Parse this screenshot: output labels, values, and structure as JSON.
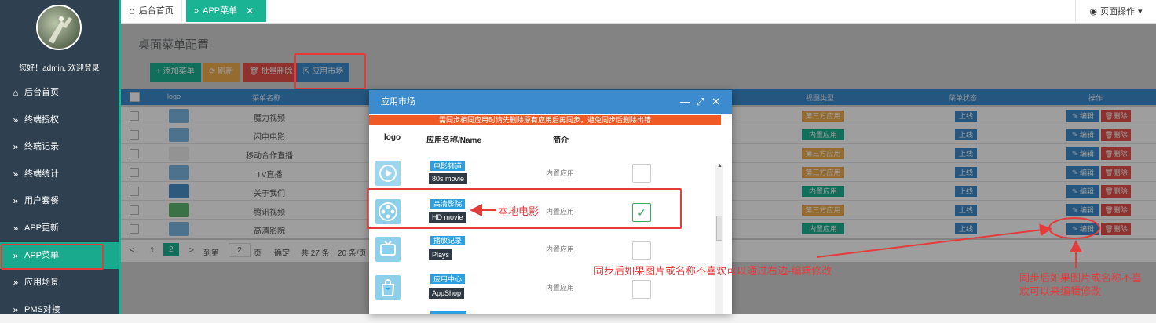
{
  "sidebar": {
    "welcome": "您好！admin, 欢迎登录",
    "items": [
      {
        "label": "后台首页",
        "icon": "home-icon"
      },
      {
        "label": "终端授权",
        "icon": "double-chevron-right-icon"
      },
      {
        "label": "终端记录",
        "icon": "double-chevron-right-icon"
      },
      {
        "label": "终端统计",
        "icon": "double-chevron-right-icon"
      },
      {
        "label": "用户套餐",
        "icon": "double-chevron-right-icon"
      },
      {
        "label": "APP更新",
        "icon": "double-chevron-right-icon"
      },
      {
        "label": "APP菜单",
        "icon": "double-chevron-right-icon",
        "active": true
      },
      {
        "label": "应用场景",
        "icon": "double-chevron-right-icon"
      },
      {
        "label": "PMS对接",
        "icon": "double-chevron-right-icon"
      }
    ]
  },
  "tabs": {
    "home": "后台首页",
    "app_menu": "APP菜单",
    "page_ops": "页面操作"
  },
  "page": {
    "title": "桌面菜单配置",
    "buttons": {
      "add": "添加菜单",
      "refresh": "刷新",
      "batch_delete": "批量删除",
      "app_market": "应用市场"
    },
    "table": {
      "headers": {
        "logo": "logo",
        "name": "菜单名称",
        "view_type": "视图类型",
        "status": "菜单状态",
        "ops": "操作"
      },
      "rows": [
        {
          "name": "魔力视频",
          "view_type": "第三方应用",
          "status": "上线"
        },
        {
          "name": "闪电电影",
          "view_type": "内置应用",
          "status": "上线"
        },
        {
          "name": "移动合作直播",
          "view_type": "第三方应用",
          "status": "上线"
        },
        {
          "name": "TV直播",
          "view_type": "第三方应用",
          "status": "上线"
        },
        {
          "name": "关于我们",
          "view_type": "内置应用",
          "status": "上线"
        },
        {
          "name": "腾讯视频",
          "view_type": "第三方应用",
          "status": "上线"
        },
        {
          "name": "高清影院",
          "view_type": "内置应用",
          "status": "上线"
        }
      ],
      "edit_label": "编辑",
      "delete_label": "删除"
    },
    "pager": {
      "prev": "<",
      "page1": "1",
      "page2": "2",
      "next": ">",
      "goto": "到第",
      "goto_value": "2",
      "page_unit": "页",
      "confirm": "确定",
      "total": "共 27 条",
      "per_page": "20 条/页"
    }
  },
  "modal": {
    "title": "应用市场",
    "warning": "需同步相同应用时请先删除原有应用后再同步，避免同步后删除出错",
    "col_logo": "logo",
    "col_name": "应用名称/Name",
    "col_desc": "简介",
    "rows": [
      {
        "cn": "电影频道",
        "en": "80s movie",
        "desc": "内置应用",
        "checked": false
      },
      {
        "cn": "高清影院",
        "en": "HD movie",
        "desc": "内置应用",
        "checked": true
      },
      {
        "cn": "播放记录",
        "en": "Plays",
        "desc": "内置应用",
        "checked": false
      },
      {
        "cn": "应用中心",
        "en": "AppShop",
        "desc": "内置应用",
        "checked": false
      }
    ]
  },
  "annotations": {
    "local_movie": "本地电影",
    "middle_note": "同步后如果图片或名称不喜欢可以通过右边-编辑修改",
    "right_note_line1": "同步后如果图片或名称不喜",
    "right_note_line2": "欢可以来编辑修改"
  },
  "colors": {
    "sidebar_bg": "#2f4050",
    "accent_green": "#1ab394",
    "header_blue": "#3b8bce",
    "warning_orange": "#f05a24",
    "annotation_red": "#e63b3b",
    "third_party_tag": "#f0ad4e",
    "builtin_tag": "#1ab394"
  }
}
